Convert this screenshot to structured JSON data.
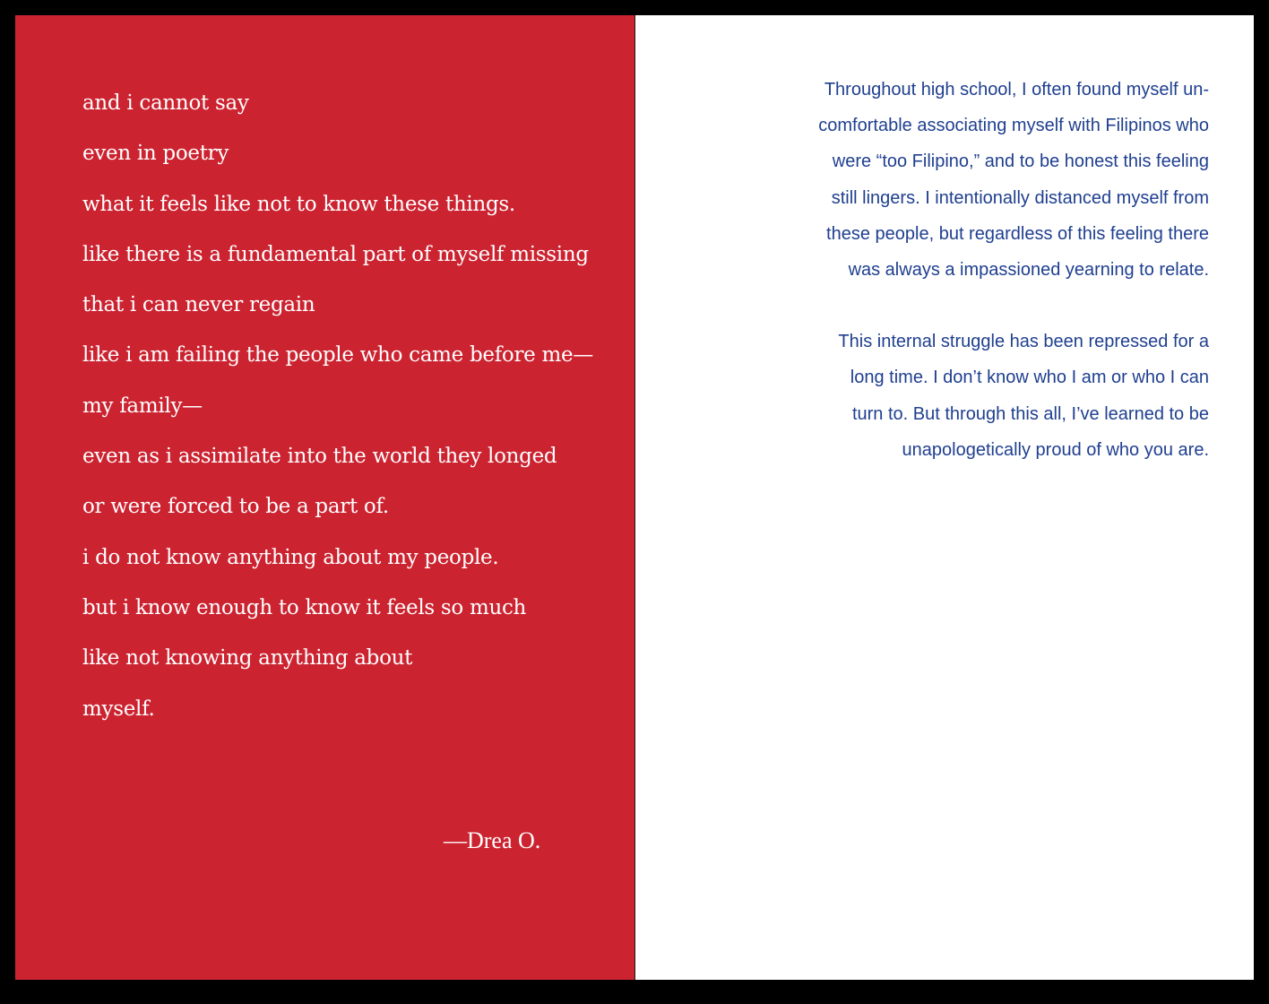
{
  "colors": {
    "background": "#000000",
    "left_page": "#cc2330",
    "right_page": "#ffffff",
    "poem_text": "#ffffff",
    "prose_text": "#1f3f8f"
  },
  "poem": {
    "lines": [
      "and i cannot say",
      "even in poetry",
      "what it feels like not to know these things.",
      "like there is a fundamental part of myself missing",
      "that i can never regain",
      "like i am failing the people who came before me—",
      "my family—",
      "even as i assimilate into the world they longed",
      "or were forced to be a part of.",
      "i do not know anything about my people.",
      "but i know enough to know it feels so much",
      "like not knowing anything about",
      "myself."
    ],
    "signature": "—Drea O."
  },
  "prose": {
    "paragraph_1": [
      "Throughout high school, I often found myself un-",
      "comfortable associating myself with Filipinos who",
      "were “too Filipino,” and to be honest this feeling",
      "still lingers. I intentionally distanced myself from",
      "these people, but regardless of this feeling there",
      "was always a impassioned yearning to relate."
    ],
    "paragraph_2": [
      "This internal struggle has been repressed for a",
      "long time. I don’t know who I am or who I can",
      "turn to. But through this all, I’ve learned to be",
      "unapologetically proud of who you are."
    ]
  }
}
